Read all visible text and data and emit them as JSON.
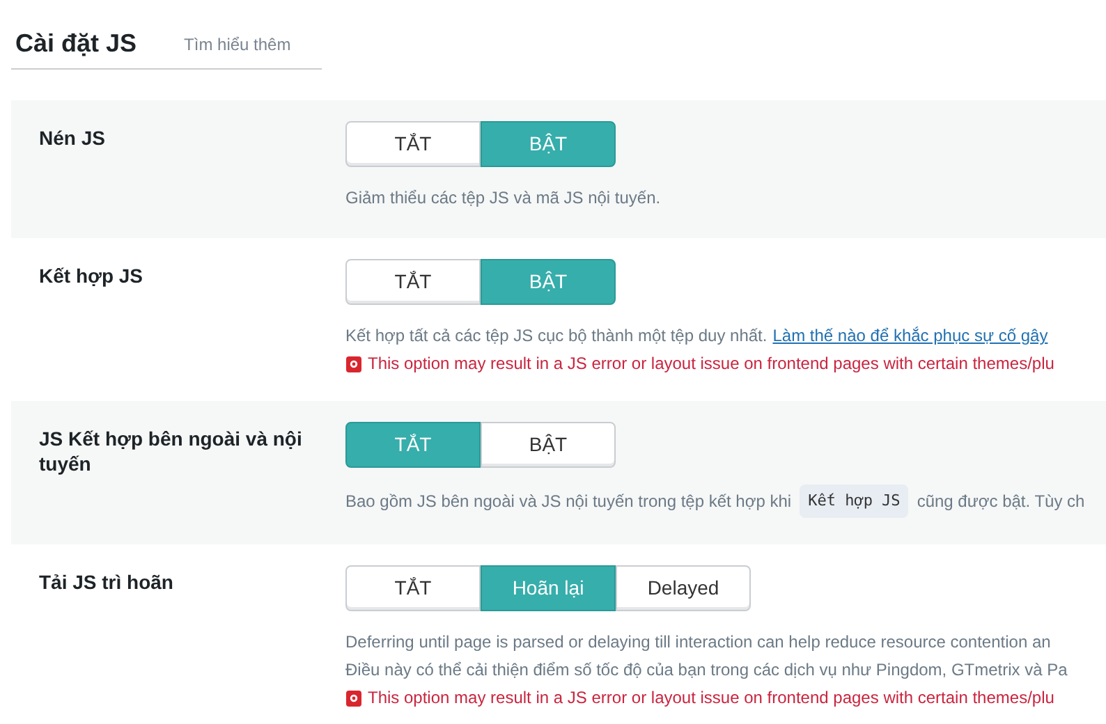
{
  "header": {
    "title": "Cài đặt JS",
    "learn_more": "Tìm hiểu thêm"
  },
  "settings": [
    {
      "label": "Nén JS",
      "options": [
        {
          "label": "TẮT",
          "selected": false
        },
        {
          "label": "BẬT",
          "selected": true
        }
      ],
      "lines": [
        {
          "kind": "note",
          "parts": [
            {
              "kind": "text",
              "text": "Giảm thiểu các tệp JS và mã JS nội tuyến."
            }
          ]
        }
      ]
    },
    {
      "label": "Kết hợp JS",
      "options": [
        {
          "label": "TẮT",
          "selected": false
        },
        {
          "label": "BẬT",
          "selected": true
        }
      ],
      "lines": [
        {
          "kind": "note",
          "parts": [
            {
              "kind": "text",
              "text": "Kết hợp tất cả các tệp JS cục bộ thành một tệp duy nhất."
            },
            {
              "kind": "link",
              "text": "Làm thế nào để khắc phục sự cố gây"
            }
          ]
        },
        {
          "kind": "warning",
          "text": "This option may result in a JS error or layout issue on frontend pages with certain themes/plu"
        }
      ]
    },
    {
      "label": "JS Kết hợp bên ngoài và nội tuyến",
      "options": [
        {
          "label": "TẮT",
          "selected": true
        },
        {
          "label": "BẬT",
          "selected": false
        }
      ],
      "lines": [
        {
          "kind": "note",
          "parts": [
            {
              "kind": "text",
              "text": "Bao gồm JS bên ngoài và JS nội tuyến trong tệp kết hợp khi"
            },
            {
              "kind": "code",
              "text": "Kết hợp JS"
            },
            {
              "kind": "text",
              "text": "cũng được bật. Tùy ch"
            }
          ]
        }
      ]
    },
    {
      "label": "Tải JS trì hoãn",
      "options": [
        {
          "label": "TẮT",
          "selected": false
        },
        {
          "label": "Hoãn lại",
          "selected": true
        },
        {
          "label": "Delayed",
          "selected": false
        }
      ],
      "lines": [
        {
          "kind": "note",
          "parts": [
            {
              "kind": "text",
              "text": "Deferring until page is parsed or delaying till interaction can help reduce resource contention an"
            }
          ]
        },
        {
          "kind": "note",
          "parts": [
            {
              "kind": "text",
              "text": "Điều này có thể cải thiện điểm số tốc độ của bạn trong các dịch vụ như Pingdom, GTmetrix và Pa"
            }
          ]
        },
        {
          "kind": "warning",
          "text": "This option may result in a JS error or layout issue on frontend pages with certain themes/plu"
        }
      ]
    }
  ]
}
